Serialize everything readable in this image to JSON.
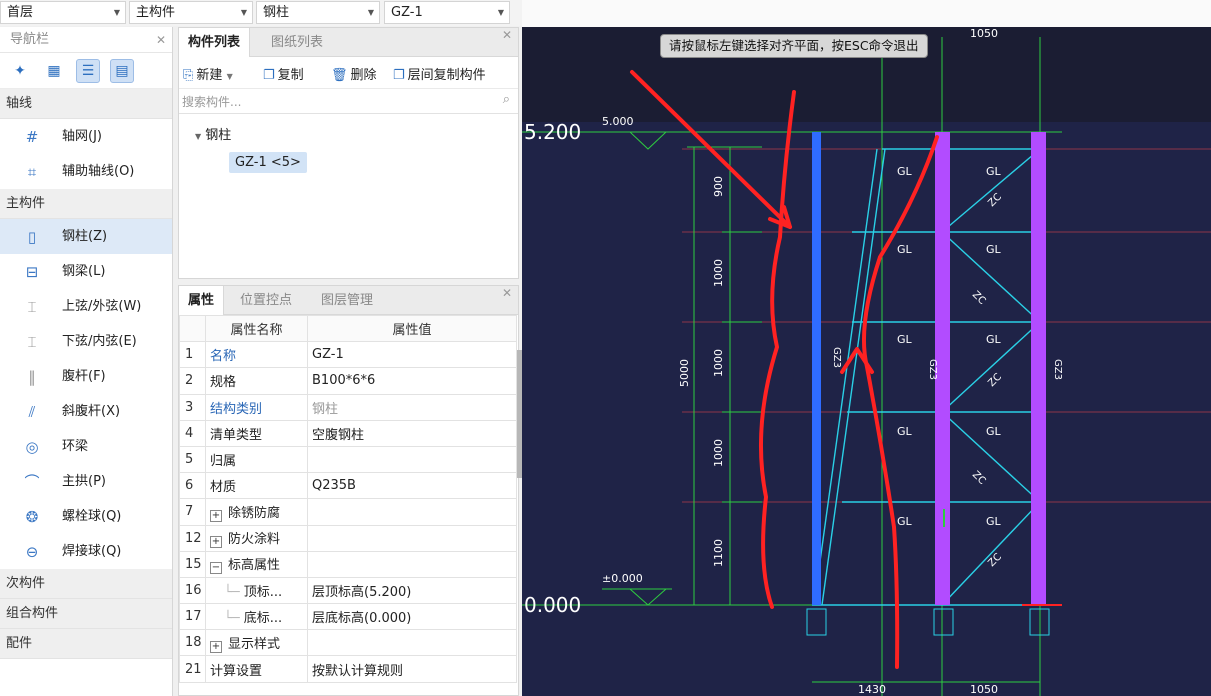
{
  "toolbar": {
    "floor": "首层",
    "category": "主构件",
    "type": "钢柱",
    "component": "GZ-1"
  },
  "nav": {
    "title": "导航栏",
    "sections": [
      {
        "label": "轴线",
        "items": [
          "轴网(J)",
          "辅助轴线(O)"
        ]
      },
      {
        "label": "主构件",
        "items": [
          "钢柱(Z)",
          "钢梁(L)",
          "上弦/外弦(W)",
          "下弦/内弦(E)",
          "腹杆(F)",
          "斜腹杆(X)",
          "环梁",
          "主拱(P)",
          "螺栓球(Q)",
          "焊接球(Q)"
        ]
      },
      {
        "label": "次构件"
      },
      {
        "label": "组合构件"
      },
      {
        "label": "配件"
      }
    ]
  },
  "complist": {
    "tabs": [
      "构件列表",
      "图纸列表"
    ],
    "actions": {
      "new": "新建",
      "copy": "复制",
      "delete": "删除",
      "floor_copy": "层间复制构件"
    },
    "search_placeholder": "搜索构件...",
    "tree_node": "钢柱",
    "tree_leaf": "GZ-1 <5>"
  },
  "props": {
    "tabs": [
      "属性",
      "位置控点",
      "图层管理"
    ],
    "col_name": "属性名称",
    "col_value": "属性值",
    "rows": [
      {
        "no": "1",
        "name": "名称",
        "value": "GZ-1"
      },
      {
        "no": "2",
        "name": "规格",
        "value": "B100*6*6"
      },
      {
        "no": "3",
        "name": "结构类别",
        "value": "钢柱"
      },
      {
        "no": "4",
        "name": "清单类型",
        "value": "空腹钢柱"
      },
      {
        "no": "5",
        "name": "归属",
        "value": ""
      },
      {
        "no": "6",
        "name": "材质",
        "value": "Q235B"
      },
      {
        "no": "7",
        "name": "除锈防腐",
        "value": ""
      },
      {
        "no": "12",
        "name": "防火涂料",
        "value": ""
      },
      {
        "no": "15",
        "name": "标高属性",
        "value": ""
      },
      {
        "no": "16",
        "name": "顶标...",
        "value": "层顶标高(5.200)"
      },
      {
        "no": "17",
        "name": "底标...",
        "value": "层底标高(0.000)"
      },
      {
        "no": "18",
        "name": "显示样式",
        "value": ""
      },
      {
        "no": "21",
        "name": "计算设置",
        "value": "按默认计算规则"
      }
    ]
  },
  "canvas": {
    "tooltip": "请按鼠标左键选择对齐平面，按ESC命令退出",
    "elev_top": "5.200",
    "elev_bottom": "0.000",
    "elev_top_mark": "5.000",
    "elev_bottom_mark": "±0.000",
    "dim_total": "5000",
    "dims_vertical": [
      "900",
      "1000",
      "1000",
      "1000",
      "1100"
    ],
    "dims_bottom": [
      "1430",
      "1050"
    ],
    "dim_top": "1050",
    "beam_label": "GL",
    "brace_label": "ZC",
    "col_label": "GZ3",
    "colors": {
      "bg": "#1f2347",
      "blue_column": "#2f6cff",
      "purple_column": "#b24cff",
      "cyan": "#2ad0e6",
      "red": "#ff2222",
      "green": "#2ecc40"
    }
  }
}
